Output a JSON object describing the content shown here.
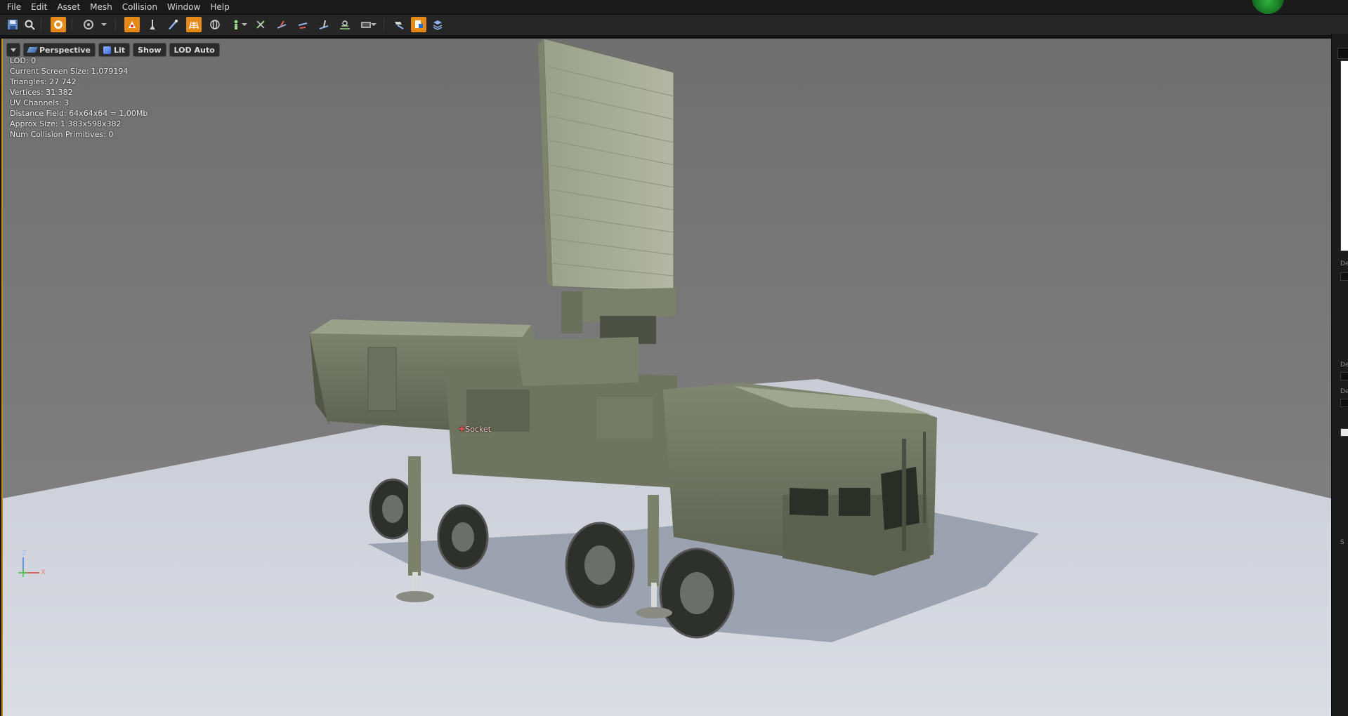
{
  "menu": {
    "items": [
      "File",
      "Edit",
      "Asset",
      "Mesh",
      "Collision",
      "Window",
      "Help"
    ]
  },
  "toolbar": {
    "buttons": [
      {
        "name": "save-icon"
      },
      {
        "name": "find-in-browser-icon"
      },
      {
        "name": "reimport-icon"
      },
      {
        "name": "camera-speed-icon"
      },
      {
        "name": "sockets-icon"
      },
      {
        "name": "pivot-icon"
      },
      {
        "name": "uv-icon"
      },
      {
        "name": "grid-icon"
      },
      {
        "name": "bounds-icon"
      },
      {
        "name": "collision-icon"
      },
      {
        "name": "normals-icon"
      },
      {
        "name": "tangents-icon"
      },
      {
        "name": "binormals-icon"
      },
      {
        "name": "vertices-icon"
      },
      {
        "name": "lod-icon"
      },
      {
        "name": "view-options-icon"
      },
      {
        "name": "reset-camera-icon"
      },
      {
        "name": "simplygon-icon"
      },
      {
        "name": "layers-icon"
      }
    ]
  },
  "viewport": {
    "perspective_label": "Perspective",
    "lit_label": "Lit",
    "show_label": "Show",
    "lod_label": "LOD Auto",
    "stats": [
      "LOD:  0",
      "Current Screen Size:  1,079194",
      "Triangles:  27 742",
      "Vertices:  31 382",
      "UV Channels:  3",
      "Distance Field:  64x64x64 = 1,00Mb",
      "Approx Size: 1 383x598x382",
      "Num Collision Primitives:  0"
    ],
    "socket_label": "Socket",
    "axis": {
      "z": "Z",
      "x": "X"
    }
  },
  "right_panel": {
    "labels": [
      "De",
      "De",
      "De",
      "S"
    ]
  },
  "colors": {
    "accent": "#e58a18",
    "viewport_border": "#c68a1a",
    "background_sky": "#7a7a7a",
    "floor": "#d4d7df",
    "vehicle": "#6d7359"
  }
}
